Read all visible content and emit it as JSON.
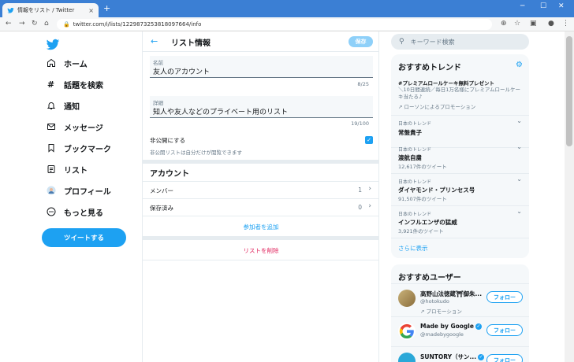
{
  "browser": {
    "tab_title": "情報をリスト / Twitter",
    "tab_close": "×",
    "new_tab": "+",
    "url": "twitter.com/i/lists/1229873253818097664/info",
    "win_min": "─",
    "win_max": "☐",
    "win_close": "✕"
  },
  "nav": {
    "items": [
      {
        "label": "ホーム",
        "icon": "home-icon"
      },
      {
        "label": "話題を検索",
        "icon": "hashtag-icon"
      },
      {
        "label": "通知",
        "icon": "bell-icon"
      },
      {
        "label": "メッセージ",
        "icon": "mail-icon"
      },
      {
        "label": "ブックマーク",
        "icon": "bookmark-icon"
      },
      {
        "label": "リスト",
        "icon": "list-icon"
      },
      {
        "label": "プロフィール",
        "icon": "avatar-icon"
      },
      {
        "label": "もっと見る",
        "icon": "more-icon"
      }
    ],
    "tweet_button": "ツイートする"
  },
  "main": {
    "title": "リスト情報",
    "save": "保存",
    "name_label": "名前",
    "name_value": "友人のアカウント",
    "name_counter": "8/25",
    "desc_label": "詳細",
    "desc_value": "知人や友人などのプライベート用のリスト",
    "desc_counter": "19/100",
    "private_label": "非公開にする",
    "private_note": "非公開リストは自分だけが閲覧できます",
    "private_checked": true,
    "account_title": "アカウント",
    "members_label": "メンバー",
    "members_count": "1",
    "saved_label": "保存済み",
    "saved_count": "0",
    "add_members": "参加者を追加",
    "delete_list": "リストを削除"
  },
  "right": {
    "search_placeholder": "キーワード検索",
    "trends_title": "おすすめトレンド",
    "promo_name": "#プレミアムロールケーキ無料プレゼント",
    "promo_desc": "＼10日間連続／毎日1万名様にプレミアムロールケーキ当たる♪",
    "promo_by": "ローソンによるプロモーション",
    "trends": [
      {
        "sub": "日本のトレンド",
        "name": "常盤貴子",
        "count": ""
      },
      {
        "sub": "日本のトレンド",
        "name": "渡航自粛",
        "count": "12,617件のツイート"
      },
      {
        "sub": "日本のトレンド",
        "name": "ダイヤモンド・プリンセス号",
        "count": "91,507件のツイート"
      },
      {
        "sub": "日本のトレンド",
        "name": "インフルエンザの猛威",
        "count": "3,921件のツイート"
      }
    ],
    "show_more": "さらに表示",
    "users_title": "おすすめユーザー",
    "users": [
      {
        "name": "高野山法徳蔵⛩御朱...",
        "handle": "@hotokudo",
        "promo": "プロモーション"
      },
      {
        "name": "Made by Google",
        "handle": "@madebygoogle",
        "promo": ""
      },
      {
        "name": "SUNTORY（サン...",
        "handle": "",
        "promo": ""
      }
    ],
    "follow": "フォロー"
  }
}
